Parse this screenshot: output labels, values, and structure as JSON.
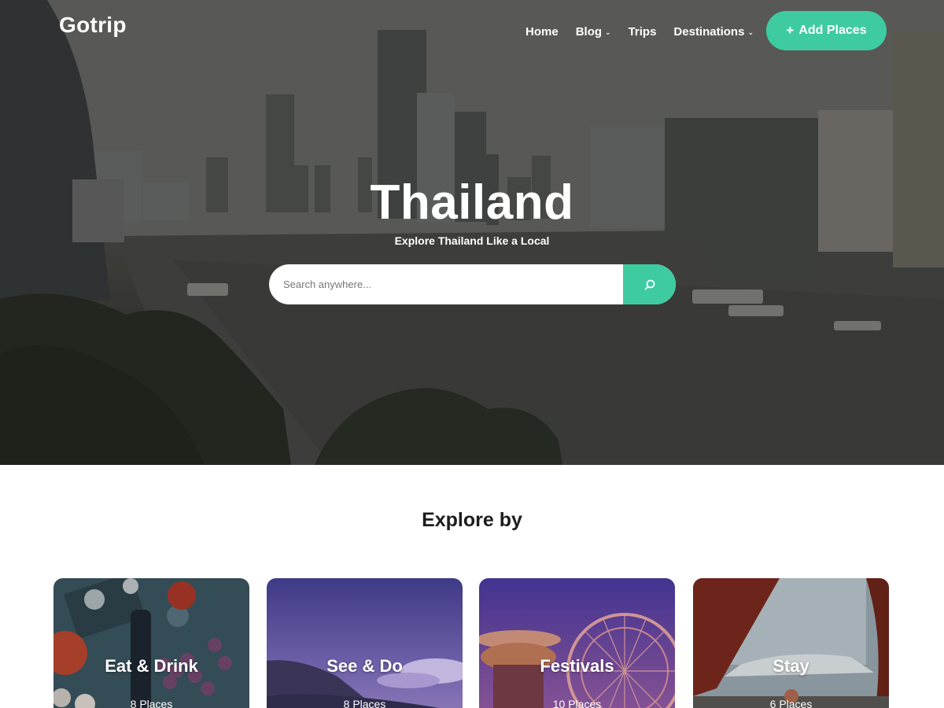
{
  "header": {
    "logo": "Gotrip",
    "nav": [
      {
        "label": "Home",
        "has_dropdown": false
      },
      {
        "label": "Blog",
        "has_dropdown": true
      },
      {
        "label": "Trips",
        "has_dropdown": false
      },
      {
        "label": "Destinations",
        "has_dropdown": true
      }
    ],
    "add_button": {
      "icon": "plus-icon",
      "label": "Add Places"
    }
  },
  "hero": {
    "title": "Thailand",
    "subtitle": "Explore Thailand Like a Local",
    "search": {
      "placeholder": "Search anywhere...",
      "value": "",
      "icon": "search-icon"
    }
  },
  "explore": {
    "title": "Explore by",
    "categories": [
      {
        "name": "Eat & Drink",
        "count": "8 Places"
      },
      {
        "name": "See & Do",
        "count": "8 Places"
      },
      {
        "name": "Festivals",
        "count": "10 Places"
      },
      {
        "name": "Stay",
        "count": "6 Places"
      }
    ]
  },
  "colors": {
    "accent": "#3ecba2",
    "text_dark": "#1d1d1d",
    "white": "#ffffff"
  }
}
